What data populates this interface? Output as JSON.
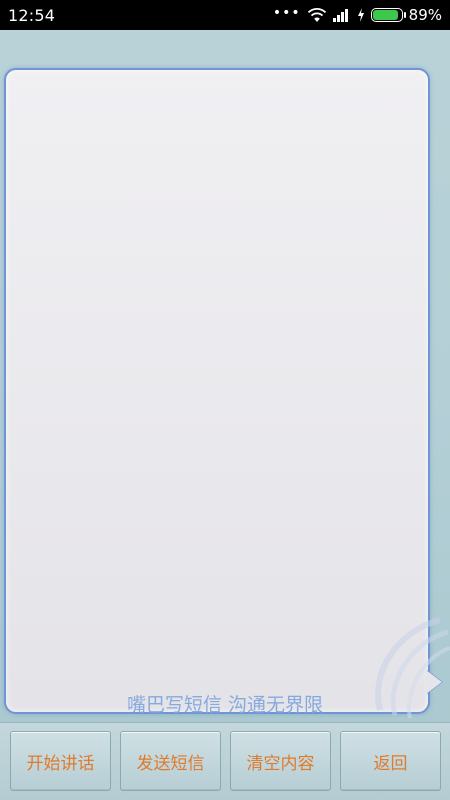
{
  "status_bar": {
    "time": "12:54",
    "dots": "•••",
    "battery_percent": "89%",
    "battery_level": 0.89,
    "battery_color": "#3cc84b"
  },
  "main": {
    "slogan": "嘴巴写短信 沟通无界限"
  },
  "toolbar": {
    "start_label": "开始讲话",
    "send_label": "发送短信",
    "clear_label": "清空内容",
    "back_label": "返回"
  },
  "colors": {
    "button_text": "#e07a2c",
    "slogan_text": "#88a9dd",
    "bubble_border": "#6f95d4"
  }
}
